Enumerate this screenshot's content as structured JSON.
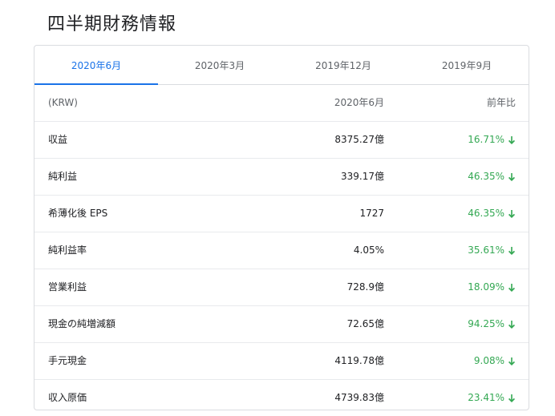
{
  "title": "四半期財務情報",
  "tabs": [
    {
      "label": "2020年6月",
      "active": true
    },
    {
      "label": "2020年3月",
      "active": false
    },
    {
      "label": "2019年12月",
      "active": false
    },
    {
      "label": "2019年9月",
      "active": false
    }
  ],
  "table": {
    "header": {
      "label": "(KRW)",
      "value": "2020年6月",
      "change": "前年比"
    },
    "rows": [
      {
        "label": "収益",
        "value": "8375.27億",
        "change": "16.71%",
        "direction": "down"
      },
      {
        "label": "純利益",
        "value": "339.17億",
        "change": "46.35%",
        "direction": "down"
      },
      {
        "label": "希薄化後 EPS",
        "value": "1727",
        "change": "46.35%",
        "direction": "down"
      },
      {
        "label": "純利益率",
        "value": "4.05%",
        "change": "35.61%",
        "direction": "down"
      },
      {
        "label": "営業利益",
        "value": "728.9億",
        "change": "18.09%",
        "direction": "down"
      },
      {
        "label": "現金の純増減額",
        "value": "72.65億",
        "change": "94.25%",
        "direction": "down"
      },
      {
        "label": "手元現金",
        "value": "4119.78億",
        "change": "9.08%",
        "direction": "down"
      },
      {
        "label": "収入原価",
        "value": "4739.83億",
        "change": "23.41%",
        "direction": "down"
      }
    ]
  },
  "colors": {
    "accent": "#1a73e8",
    "change_down": "#34a853",
    "text_primary": "#202124",
    "text_secondary": "#5f6368",
    "border": "#dadce0"
  },
  "icons": {
    "change_arrow": "arrow-down-icon"
  }
}
